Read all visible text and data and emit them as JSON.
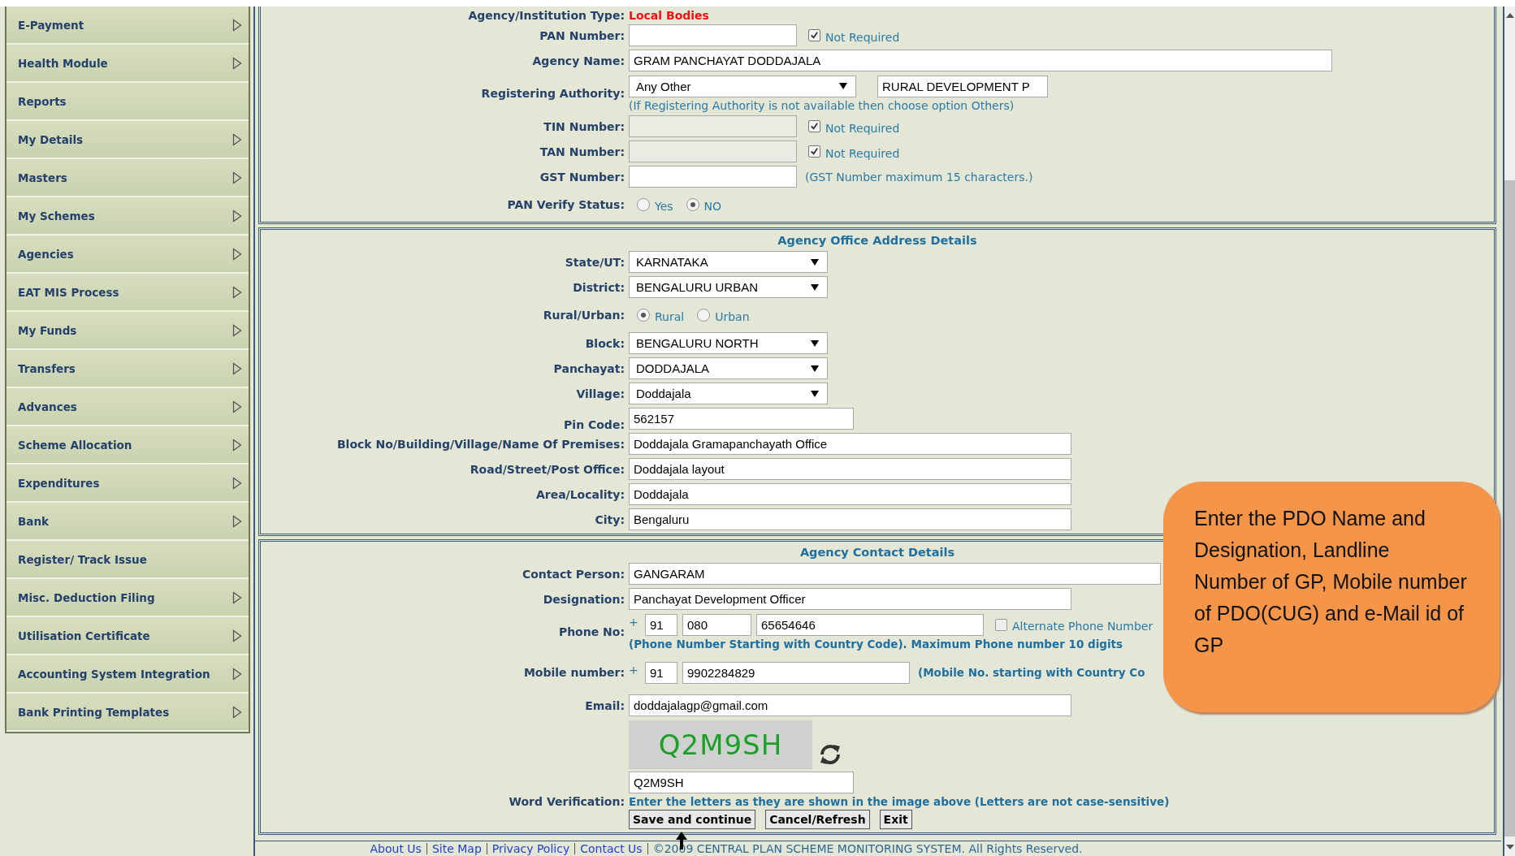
{
  "sidebar": {
    "items": [
      {
        "label": "E-Payment",
        "has_submenu": true
      },
      {
        "label": "Health Module",
        "has_submenu": true
      },
      {
        "label": "Reports",
        "has_submenu": false
      },
      {
        "label": "My Details",
        "has_submenu": true
      },
      {
        "label": "Masters",
        "has_submenu": true
      },
      {
        "label": "My Schemes",
        "has_submenu": true
      },
      {
        "label": "Agencies",
        "has_submenu": true
      },
      {
        "label": "EAT MIS Process",
        "has_submenu": true
      },
      {
        "label": "My Funds",
        "has_submenu": true
      },
      {
        "label": "Transfers",
        "has_submenu": true
      },
      {
        "label": "Advances",
        "has_submenu": true
      },
      {
        "label": "Scheme Allocation",
        "has_submenu": true
      },
      {
        "label": "Expenditures",
        "has_submenu": true
      },
      {
        "label": "Bank",
        "has_submenu": true
      },
      {
        "label": "Register/ Track Issue",
        "has_submenu": false
      },
      {
        "label": "Misc. Deduction Filing",
        "has_submenu": true
      },
      {
        "label": "Utilisation Certificate",
        "has_submenu": true
      },
      {
        "label": "Accounting System Integration",
        "has_submenu": true
      },
      {
        "label": "Bank Printing Templates",
        "has_submenu": true
      }
    ]
  },
  "identity": {
    "rows": [
      {
        "kind": "info",
        "label": "Agency/Institution Type:",
        "value": "Local Bodies"
      },
      {
        "kind": "short",
        "label": "PAN Number:",
        "checkbox": {
          "label": "Not Required",
          "checked": true
        }
      },
      {
        "kind": "wide",
        "label": "Agency Name:",
        "value": "GRAM PANCHAYAT DODDAJALA"
      },
      {
        "kind": "select_text",
        "label": "Registering Authority:",
        "value": "Any Other",
        "extra": "RURAL DEVELOPMENT P",
        "hint": "(If Registering Authority is not available then choose option Others)"
      },
      {
        "kind": "short",
        "label": "TIN Number:",
        "disabled": true,
        "checkbox": {
          "label": "Not Required",
          "checked": true
        }
      },
      {
        "kind": "short",
        "label": "TAN Number:",
        "disabled": true,
        "checkbox": {
          "label": "Not Required",
          "checked": true
        }
      },
      {
        "kind": "short",
        "label": "GST Number:",
        "disabled": false,
        "note": "(GST Number maximum 15 characters.)"
      },
      {
        "kind": "radio",
        "label": "PAN Verify Status:",
        "options": [
          {
            "label": "Yes",
            "selected": false
          },
          {
            "label": "NO",
            "selected": true
          }
        ]
      }
    ]
  },
  "office_address": {
    "title": "Agency Office Address Details",
    "rows": [
      {
        "kind": "select",
        "label": "State/UT:",
        "value": "KARNATAKA"
      },
      {
        "kind": "select",
        "label": "District:",
        "value": "BENGALURU URBAN"
      },
      {
        "kind": "radio",
        "label": "Rural/Urban:",
        "options": [
          {
            "label": "Rural",
            "selected": true
          },
          {
            "label": "Urban",
            "selected": false
          }
        ]
      },
      {
        "kind": "select",
        "label": "Block:",
        "value": "BENGALURU NORTH"
      },
      {
        "kind": "select",
        "label": "Panchayat:",
        "value": "DODDAJALA"
      },
      {
        "kind": "select",
        "label": "Village:",
        "value": "Doddajala"
      },
      {
        "kind": "medium",
        "label": "Pin Code:",
        "value": "562157"
      },
      {
        "kind": "long",
        "label": "Block No/Building/Village/Name Of Premises:",
        "value": "Doddajala Gramapanchayath Office"
      },
      {
        "kind": "long",
        "label": "Road/Street/Post Office:",
        "value": "Doddajala layout"
      },
      {
        "kind": "long",
        "label": "Area/Locality:",
        "value": "Doddajala"
      },
      {
        "kind": "long",
        "label": "City:",
        "value": "Bengaluru"
      }
    ]
  },
  "contact": {
    "title": "Agency Contact Details",
    "rows": [
      {
        "kind": "xlong",
        "label": "Contact Person:",
        "value": "GANGARAM"
      },
      {
        "kind": "long",
        "label": "Designation:",
        "value": "Panchayat Development Officer"
      },
      {
        "kind": "phone",
        "label": "Phone No:",
        "prefix": "+",
        "parts": [
          "91",
          "080",
          "65654646"
        ],
        "checkbox": {
          "label": "Alternate Phone Number",
          "checked": false
        },
        "hint": "(Phone Number Starting with Country Code). Maximum Phone number 10 digits"
      },
      {
        "kind": "phone",
        "label": "Mobile number:",
        "prefix": "+",
        "parts": [
          "91",
          "9902284829"
        ],
        "note": "(Mobile No. starting with Country Co"
      },
      {
        "kind": "long",
        "label": "Email:",
        "value": "doddajalagp@gmail.com"
      },
      {
        "kind": "captcha",
        "value": "Q2M9SH"
      },
      {
        "kind": "medium",
        "label": "Word Verification:",
        "value": "Q2M9SH",
        "hint": "Enter the letters as they are shown in the image above (Letters are not case-sensitive)"
      }
    ],
    "buttons": [
      "Save and continue",
      "Cancel/Refresh",
      "Exit"
    ]
  },
  "footer": {
    "links": [
      "About Us",
      "Site Map",
      "Privacy Policy",
      "Contact Us"
    ],
    "copyright": "©2009 CENTRAL PLAN SCHEME MONITORING SYSTEM. All Rights Reserved."
  },
  "callout": {
    "text": "Enter the PDO Name and Designation, Landline Number of GP, Mobile number of PDO(CUG) and e-Mail id of GP"
  }
}
